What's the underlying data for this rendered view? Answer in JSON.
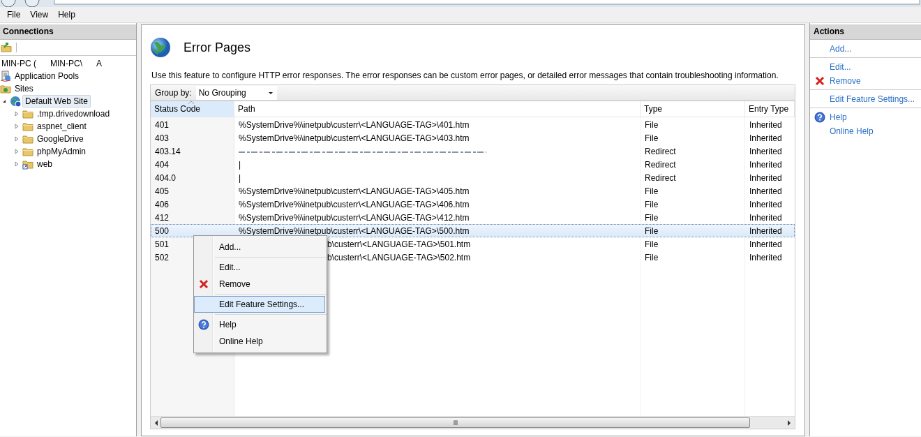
{
  "menu_bar": [
    {
      "label": "File"
    },
    {
      "label": "View"
    },
    {
      "label": "Help"
    }
  ],
  "connections": {
    "title": "Connections",
    "server_node": [
      "MIN-PC (",
      "MIN-PC\\",
      "A"
    ],
    "tree": [
      {
        "label": "Application Pools",
        "kind": "pools",
        "selected": false
      },
      {
        "label": "Sites",
        "kind": "sites",
        "selected": false
      },
      {
        "label": "Default Web Site",
        "kind": "site",
        "selected": true,
        "expanded": true,
        "children": [
          {
            "label": ".tmp.drivedownload",
            "kind": "folder",
            "selected": false,
            "expanded": false
          },
          {
            "label": "aspnet_client",
            "kind": "folder",
            "selected": false,
            "expanded": false
          },
          {
            "label": "GoogleDrive",
            "kind": "folder",
            "selected": false,
            "expanded": false
          },
          {
            "label": "phpMyAdmin",
            "kind": "folder",
            "selected": false,
            "expanded": false
          },
          {
            "label": "web",
            "kind": "virtual",
            "selected": false,
            "expanded": false
          }
        ]
      }
    ]
  },
  "feature": {
    "title": "Error Pages",
    "description": "Use this feature to configure HTTP error responses. The error responses can be custom error pages, or detailed error messages that contain troubleshooting information.",
    "group_by": {
      "label": "Group by:",
      "value": "No Grouping"
    },
    "columns": [
      {
        "label": "Status Code",
        "sorted": true
      },
      {
        "label": "Path",
        "sorted": false
      },
      {
        "label": "Type",
        "sorted": false
      },
      {
        "label": "Entry Type",
        "sorted": false
      }
    ],
    "rows": [
      {
        "status": "401",
        "kind": "plain",
        "path": "%SystemDrive%\\inetpub\\custerr\\<LANGUAGE-TAG>\\401.htm",
        "type": "File",
        "entry_type": "Inherited",
        "selected": false
      },
      {
        "status": "403",
        "kind": "plain",
        "path": "%SystemDrive%\\inetpub\\custerr\\<LANGUAGE-TAG>\\403.htm",
        "type": "File",
        "entry_type": "Inherited",
        "selected": false
      },
      {
        "status": "403.14",
        "kind": "redacted",
        "type": "Redirect",
        "entry_type": "Inherited",
        "selected": false
      },
      {
        "status": "404",
        "kind": "plain",
        "path": "|",
        "type": "Redirect",
        "entry_type": "Inherited",
        "selected": false
      },
      {
        "status": "404.0",
        "kind": "plain",
        "path": "|",
        "type": "Redirect",
        "entry_type": "Inherited",
        "selected": false
      },
      {
        "status": "405",
        "kind": "plain",
        "path": "%SystemDrive%\\inetpub\\custerr\\<LANGUAGE-TAG>\\405.htm",
        "type": "File",
        "entry_type": "Inherited",
        "selected": false
      },
      {
        "status": "406",
        "kind": "plain",
        "path": "%SystemDrive%\\inetpub\\custerr\\<LANGUAGE-TAG>\\406.htm",
        "type": "File",
        "entry_type": "Inherited",
        "selected": false
      },
      {
        "status": "412",
        "kind": "plain",
        "path": "%SystemDrive%\\inetpub\\custerr\\<LANGUAGE-TAG>\\412.htm",
        "type": "File",
        "entry_type": "Inherited",
        "selected": false
      },
      {
        "status": "500",
        "kind": "plain",
        "path": "%SystemDrive%\\inetpub\\custerr\\<LANGUAGE-TAG>\\500.htm",
        "type": "File",
        "entry_type": "Inherited",
        "selected": true
      },
      {
        "status": "501",
        "kind": "covered",
        "path": "b\\custerr\\<LANGUAGE-TAG>\\501.htm",
        "type": "File",
        "entry_type": "Inherited",
        "selected": false
      },
      {
        "status": "502",
        "kind": "covered",
        "path": "b\\custerr\\<LANGUAGE-TAG>\\502.htm",
        "type": "File",
        "entry_type": "Inherited",
        "selected": false
      }
    ]
  },
  "context_menu": {
    "groups": [
      [
        {
          "label": "Add...",
          "kind": "plain",
          "selected": false
        }
      ],
      [
        {
          "label": "Edit...",
          "kind": "plain",
          "selected": false
        },
        {
          "label": "Remove",
          "kind": "remove",
          "selected": false
        }
      ],
      [
        {
          "label": "Edit Feature Settings...",
          "kind": "plain",
          "selected": true
        }
      ],
      [
        {
          "label": "Help",
          "kind": "help",
          "selected": false
        },
        {
          "label": "Online Help",
          "kind": "plain",
          "selected": false
        }
      ]
    ]
  },
  "actions": {
    "title": "Actions",
    "groups": [
      [
        {
          "label": "Add...",
          "kind": "plain"
        }
      ],
      [
        {
          "label": "Edit...",
          "kind": "plain"
        },
        {
          "label": "Remove",
          "kind": "remove"
        }
      ],
      [
        {
          "label": "Edit Feature Settings...",
          "kind": "plain"
        }
      ],
      [
        {
          "label": "Help",
          "kind": "help"
        },
        {
          "label": "Online Help",
          "kind": "plain"
        }
      ]
    ]
  }
}
